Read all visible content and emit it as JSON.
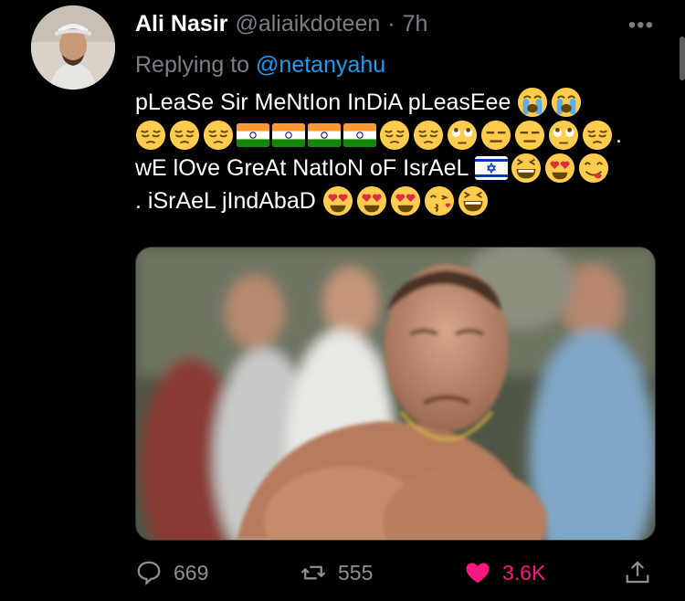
{
  "tweet": {
    "author_name": "Ali Nasir",
    "author_handle": "@aliaikdoteen",
    "separator": "·",
    "time": "7h",
    "reply_prefix": "Replying to ",
    "reply_to": "@netanyahu",
    "text_line1": "pLeaSe Sir MeNtIon InDiA pLeasEee",
    "text_line3": "wE lOve GreAt NatIoN oF IsrAeL",
    "text_line4": ".  iSrAeL jIndAbaD",
    "line2_end": ".",
    "icons": {
      "more": "more-dots-icon",
      "reply": "reply-icon",
      "retweet": "retweet-icon",
      "like": "heart-icon",
      "share": "share-icon"
    }
  },
  "stats": {
    "replies": "669",
    "retweets": "555",
    "likes": "3.6K"
  },
  "colors": {
    "background": "#000000",
    "text": "#ffffff",
    "muted": "#7a7f85",
    "mention": "#1d9bf0",
    "like": "#f91880"
  }
}
